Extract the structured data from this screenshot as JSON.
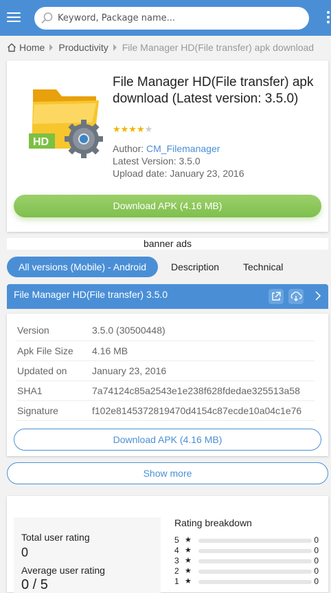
{
  "search": {
    "placeholder": "Keyword, Package name..."
  },
  "breadcrumb": {
    "home": "Home",
    "category": "Productivity",
    "current": "File Manager HD(File transfer) apk download"
  },
  "app": {
    "title": "File Manager HD(File transfer) apk download (Latest version: 3.5.0)",
    "stars_filled": "★★★★",
    "stars_empty": "★",
    "author_label": "Author: ",
    "author": "CM_Filemanager",
    "latest_version": "Latest Version: 3.5.0",
    "upload_date": "Upload date: January 23, 2016",
    "download_label": "Download APK (4.16 MB)"
  },
  "banner": "banner ads",
  "tabs": {
    "all_versions": "All versions (Mobile) - Android",
    "description": "Description",
    "technical": "Technical"
  },
  "version_bar": {
    "label": "File Manager HD(File transfer) 3.5.0"
  },
  "details": {
    "rows": [
      {
        "key": "Version",
        "value": "3.5.0 (30500448)"
      },
      {
        "key": "Apk File Size",
        "value": "4.16 MB"
      },
      {
        "key": "Updated on",
        "value": "January 23, 2016"
      },
      {
        "key": "SHA1",
        "value": "7a74124c85a2543e1e238f628fdedae325513a58"
      },
      {
        "key": "Signature",
        "value": "f102e8145372819470d4154c87ecde10a04c1e76"
      }
    ],
    "download_label": "Download APK (4.16 MB)"
  },
  "show_more": "Show more",
  "rating": {
    "total_label": "Total user rating",
    "total_value": "0",
    "average_label": "Average user rating",
    "average_value": "0 / 5",
    "breakdown_title": "Rating breakdown",
    "breakdown": [
      {
        "stars": "5",
        "count": "0"
      },
      {
        "stars": "4",
        "count": "0"
      },
      {
        "stars": "3",
        "count": "0"
      },
      {
        "stars": "2",
        "count": "0"
      },
      {
        "stars": "1",
        "count": "0"
      }
    ],
    "star_glyph": "★"
  },
  "colors": {
    "accent": "#4a8fd6",
    "download_green": "#8cc95c",
    "star": "#f5b400"
  }
}
